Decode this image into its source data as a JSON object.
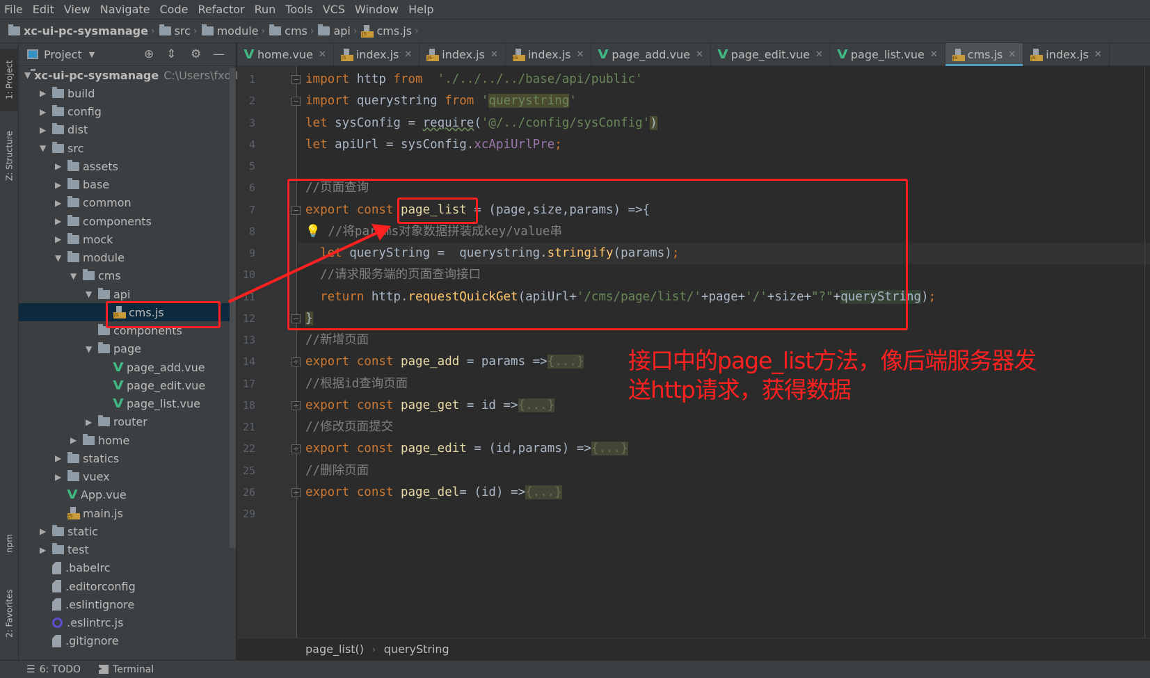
{
  "menu": [
    "File",
    "Edit",
    "View",
    "Navigate",
    "Code",
    "Refactor",
    "Run",
    "Tools",
    "VCS",
    "Window",
    "Help"
  ],
  "nav_breadcrumb": [
    {
      "label": "xc-ui-pc-sysmanage",
      "icon": "folder-icon"
    },
    {
      "label": "src",
      "icon": "folder-icon"
    },
    {
      "label": "module",
      "icon": "folder-icon"
    },
    {
      "label": "cms",
      "icon": "folder-icon"
    },
    {
      "label": "api",
      "icon": "folder-icon"
    },
    {
      "label": "cms.js",
      "icon": "js-file-icon"
    }
  ],
  "left_strip": {
    "top": [
      "1: Project",
      "Z: Structure"
    ],
    "bottom": [
      "npm",
      "2: Favorites"
    ]
  },
  "project": {
    "title": "Project",
    "root_path": "C:\\Users\\fxd\\D",
    "tree": [
      {
        "label": "xc-ui-pc-sysmanage",
        "level": 0,
        "type": "folder",
        "state": "open",
        "bold": true
      },
      {
        "label": "build",
        "level": 1,
        "type": "folder",
        "state": "closed"
      },
      {
        "label": "config",
        "level": 1,
        "type": "folder",
        "state": "closed"
      },
      {
        "label": "dist",
        "level": 1,
        "type": "folder",
        "state": "closed"
      },
      {
        "label": "src",
        "level": 1,
        "type": "folder",
        "state": "open"
      },
      {
        "label": "assets",
        "level": 2,
        "type": "folder",
        "state": "closed"
      },
      {
        "label": "base",
        "level": 2,
        "type": "folder",
        "state": "closed"
      },
      {
        "label": "common",
        "level": 2,
        "type": "folder",
        "state": "closed"
      },
      {
        "label": "components",
        "level": 2,
        "type": "folder",
        "state": "closed"
      },
      {
        "label": "mock",
        "level": 2,
        "type": "folder",
        "state": "closed"
      },
      {
        "label": "module",
        "level": 2,
        "type": "folder",
        "state": "open"
      },
      {
        "label": "cms",
        "level": 3,
        "type": "folder",
        "state": "open"
      },
      {
        "label": "api",
        "level": 4,
        "type": "folder",
        "state": "open"
      },
      {
        "label": "cms.js",
        "level": 5,
        "type": "js",
        "selected": true
      },
      {
        "label": "components",
        "level": 4,
        "type": "folder",
        "state": "none"
      },
      {
        "label": "page",
        "level": 4,
        "type": "folder",
        "state": "open"
      },
      {
        "label": "page_add.vue",
        "level": 5,
        "type": "vue"
      },
      {
        "label": "page_edit.vue",
        "level": 5,
        "type": "vue"
      },
      {
        "label": "page_list.vue",
        "level": 5,
        "type": "vue"
      },
      {
        "label": "router",
        "level": 4,
        "type": "folder",
        "state": "closed"
      },
      {
        "label": "home",
        "level": 3,
        "type": "folder",
        "state": "closed"
      },
      {
        "label": "statics",
        "level": 2,
        "type": "folder",
        "state": "closed"
      },
      {
        "label": "vuex",
        "level": 2,
        "type": "folder",
        "state": "closed"
      },
      {
        "label": "App.vue",
        "level": 2,
        "type": "vue"
      },
      {
        "label": "main.js",
        "level": 2,
        "type": "js"
      },
      {
        "label": "static",
        "level": 1,
        "type": "folder",
        "state": "closed"
      },
      {
        "label": "test",
        "level": 1,
        "type": "folder",
        "state": "closed"
      },
      {
        "label": ".babelrc",
        "level": 1,
        "type": "file"
      },
      {
        "label": ".editorconfig",
        "level": 1,
        "type": "file"
      },
      {
        "label": ".eslintignore",
        "level": 1,
        "type": "file"
      },
      {
        "label": ".eslintrc.js",
        "level": 1,
        "type": "eslint"
      },
      {
        "label": ".gitignore",
        "level": 1,
        "type": "file"
      }
    ]
  },
  "tabs": [
    {
      "label": "home.vue",
      "type": "vue"
    },
    {
      "label": "index.js",
      "type": "js"
    },
    {
      "label": "index.js",
      "type": "js"
    },
    {
      "label": "index.js",
      "type": "js"
    },
    {
      "label": "page_add.vue",
      "type": "vue"
    },
    {
      "label": "page_edit.vue",
      "type": "vue"
    },
    {
      "label": "page_list.vue",
      "type": "vue"
    },
    {
      "label": "cms.js",
      "type": "js",
      "active": true
    },
    {
      "label": "index.js",
      "type": "js"
    }
  ],
  "editor": {
    "current_line": 9,
    "lines": [
      {
        "n": "1",
        "fold": "open",
        "t": [
          [
            "import",
            "kw"
          ],
          " http ",
          [
            "from",
            "kw"
          ],
          [
            "  './../../../base/api/public'",
            "str"
          ]
        ]
      },
      {
        "n": "2",
        "fold": "close",
        "t": [
          [
            "import",
            "kw"
          ],
          " querystring ",
          [
            "from",
            "kw"
          ],
          [
            " '",
            "str"
          ],
          [
            "querystring",
            "str hl"
          ],
          [
            "'",
            "str"
          ]
        ]
      },
      {
        "n": "3",
        "t": [
          [
            "let",
            "kw"
          ],
          " sysConfig = ",
          [
            "require",
            "ul"
          ],
          "(",
          [
            "'@/../config/sysConfig'",
            "str"
          ],
          [
            ")",
            "hl"
          ]
        ]
      },
      {
        "n": "4",
        "t": [
          [
            "let",
            "kw"
          ],
          " apiUrl = sysConfig.",
          [
            "xcApiUrlPre",
            "pu"
          ],
          [
            ";",
            "kw"
          ]
        ]
      },
      {
        "n": "5",
        "t": []
      },
      {
        "n": "6",
        "t": [
          [
            "//页面查询",
            "cm"
          ]
        ]
      },
      {
        "n": "7",
        "fold": "open",
        "t": [
          [
            "export const",
            "kw"
          ],
          " ",
          [
            "page_list",
            "fnd"
          ],
          " = (page,size,params) =>{"
        ]
      },
      {
        "n": "8",
        "bulb": true,
        "t": [
          " ",
          [
            "//将params对象数据拼装成key/value串",
            "cm"
          ]
        ]
      },
      {
        "n": "9",
        "t": [
          "  ",
          [
            "let",
            "kw"
          ],
          " queryString =  querystring.",
          [
            "stringify",
            "fn"
          ],
          "(params)",
          [
            ";",
            "kw"
          ]
        ]
      },
      {
        "n": "10",
        "t": [
          "  ",
          [
            "//请求服务端的页面查询接口",
            "cm"
          ]
        ]
      },
      {
        "n": "11",
        "t": [
          "  ",
          [
            "return",
            "kw"
          ],
          " http.",
          [
            "requestQuickGet",
            "fn"
          ],
          "(apiUrl+",
          [
            "'/cms/page/list/'",
            "str"
          ],
          "+page+",
          [
            "'/'",
            "str"
          ],
          "+size+",
          [
            "\"?\"",
            "str"
          ],
          "+",
          [
            "queryString",
            "hl2"
          ],
          ")",
          [
            ";",
            "kw"
          ]
        ]
      },
      {
        "n": "12",
        "fold": "close",
        "t": [
          [
            "}",
            "hl"
          ]
        ]
      },
      {
        "n": "13",
        "t": [
          [
            "//新增页面",
            "cm"
          ]
        ]
      },
      {
        "n": "14",
        "fold": "plus",
        "t": [
          [
            "export const",
            "kw"
          ],
          " ",
          [
            "page_add",
            "fnd"
          ],
          " = params =>",
          [
            "{...}",
            "fd"
          ]
        ]
      },
      {
        "n": "17",
        "t": [
          [
            "//根据id查询页面",
            "cm"
          ]
        ]
      },
      {
        "n": "18",
        "fold": "plus",
        "t": [
          [
            "export const",
            "kw"
          ],
          " ",
          [
            "page_get",
            "fnd"
          ],
          " = id =>",
          [
            "{...}",
            "fd"
          ]
        ]
      },
      {
        "n": "21",
        "t": [
          [
            "//修改页面提交",
            "cm"
          ]
        ]
      },
      {
        "n": "22",
        "fold": "plus",
        "t": [
          [
            "export const",
            "kw"
          ],
          " ",
          [
            "page_edit",
            "fnd"
          ],
          " = (id,params) =>",
          [
            "{...}",
            "fd"
          ]
        ]
      },
      {
        "n": "25",
        "t": [
          [
            "//删除页面",
            "cm"
          ]
        ]
      },
      {
        "n": "26",
        "fold": "plus",
        "t": [
          [
            "export const",
            "kw"
          ],
          " ",
          [
            "page_del",
            "fnd"
          ],
          "= (id) =>",
          [
            "{...}",
            "fd"
          ]
        ]
      },
      {
        "n": "29",
        "t": []
      }
    ]
  },
  "code_breadcrumb": [
    "page_list()",
    "queryString"
  ],
  "status": {
    "todo": "6: TODO",
    "terminal": "Terminal"
  },
  "annotation": {
    "line1": "接口中的page_list方法，像后端服务器发",
    "line2": "送http请求，获得数据",
    "color": "#ff2020"
  }
}
